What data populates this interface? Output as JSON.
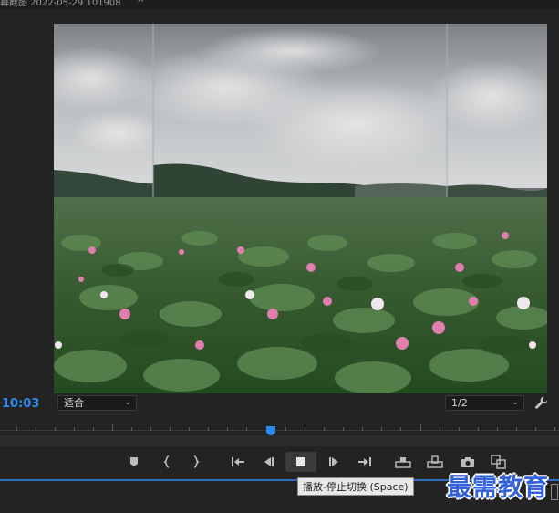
{
  "window": {
    "title": "幕截图 2022-05-29 101908",
    "close_glyph": "×"
  },
  "monitor": {
    "timecode": "10:03",
    "zoom_select": "适合",
    "resolution_select": "1/2",
    "settings_icon": "wrench-icon"
  },
  "transport": {
    "buttons": [
      {
        "name": "add-marker-button",
        "icon": "marker-icon"
      },
      {
        "name": "mark-in-button",
        "icon": "mark-in-icon"
      },
      {
        "name": "mark-out-button",
        "icon": "mark-out-icon"
      },
      {
        "name": "go-to-in-button",
        "icon": "go-to-in-icon"
      },
      {
        "name": "step-back-button",
        "icon": "step-back-icon"
      },
      {
        "name": "play-stop-button",
        "icon": "stop-icon"
      },
      {
        "name": "step-forward-button",
        "icon": "step-forward-icon"
      },
      {
        "name": "go-to-out-button",
        "icon": "go-to-out-icon"
      },
      {
        "name": "insert-button",
        "icon": "insert-icon"
      },
      {
        "name": "overwrite-button",
        "icon": "overwrite-icon"
      },
      {
        "name": "export-frame-button",
        "icon": "camera-icon"
      },
      {
        "name": "button-editor-button",
        "icon": "button-editor-icon"
      }
    ],
    "tooltip": "播放-停止切换 (Space)"
  },
  "watermark": "最需教育",
  "colors": {
    "accent": "#2d8ceb",
    "panel_bg": "#232323",
    "playhead": "#2d8ceb"
  }
}
